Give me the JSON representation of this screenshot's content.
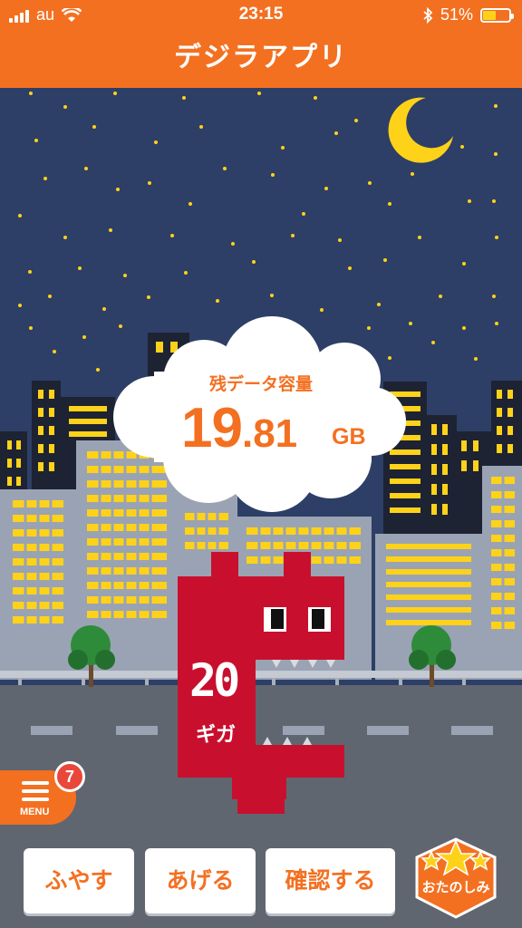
{
  "status_bar": {
    "carrier": "au",
    "time": "23:15",
    "battery_percent": "51%",
    "battery_level": 0.51
  },
  "header": {
    "title": "デジラアプリ"
  },
  "data_cloud": {
    "label": "残データ容量",
    "value_int": "19",
    "value_dec": ".81",
    "unit": "GB"
  },
  "monster": {
    "number": "20",
    "label": "ギガ"
  },
  "menu": {
    "label": "MENU",
    "badge": "7"
  },
  "actions": {
    "increase": "ふやす",
    "give": "あげる",
    "check": "確認する",
    "fun": "おたのしみ"
  },
  "colors": {
    "brand": "#f37021",
    "sky": "#2d3f66",
    "monster": "#c8102e",
    "badge": "#e8473a"
  }
}
